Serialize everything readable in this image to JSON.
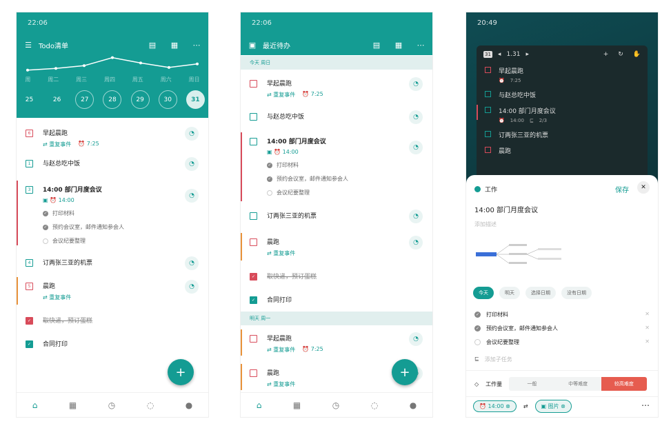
{
  "p1": {
    "time": "22:06",
    "title": "Todo清单",
    "badge": "8",
    "week": [
      "周",
      "周二",
      "周三",
      "周四",
      "周五",
      "周六",
      "周日"
    ],
    "dates": [
      "25",
      "26",
      "27",
      "28",
      "29",
      "30",
      "31"
    ],
    "trend": [
      0.2,
      0.3,
      0.45,
      0.9,
      0.6,
      0.35,
      0.55
    ],
    "items": [
      {
        "t": "早起晨跑",
        "meta1": "重复事件",
        "meta2": "7:25",
        "n": "6"
      },
      {
        "t": "与赵总吃中饭",
        "n": "1"
      },
      {
        "t": "14:00 部门月度会议",
        "meta2": "14:00",
        "n": "3",
        "subs": [
          "打印材料",
          "预约会议室，邮件通知参会人",
          "会议纪要整理"
        ]
      },
      {
        "t": "订两张三亚的机票",
        "n": "4"
      },
      {
        "t": "晨跑",
        "meta1": "重复事件",
        "n": "5"
      },
      {
        "t": "取快递，预订蛋糕"
      },
      {
        "t": "合同打印"
      }
    ]
  },
  "p2": {
    "time": "22:06",
    "title": "最近待办",
    "today": "今天 周日",
    "tomorrow": "明天 周一",
    "items": [
      {
        "t": "早起晨跑",
        "meta1": "重复事件",
        "meta2": "7:25"
      },
      {
        "t": "与赵总吃中饭"
      },
      {
        "t": "14:00 部门月度会议",
        "meta2": "14:00",
        "subs": [
          "打印材料",
          "预约会议室，邮件通知参会人",
          "会议纪要整理"
        ]
      },
      {
        "t": "订两张三亚的机票"
      },
      {
        "t": "晨跑",
        "meta1": "重复事件"
      },
      {
        "t": "取快递，预订蛋糕"
      },
      {
        "t": "合同打印"
      }
    ],
    "tm": [
      {
        "t": "早起晨跑",
        "meta1": "重复事件",
        "meta2": "7:25"
      },
      {
        "t": "晨跑",
        "meta1": "重复事件"
      }
    ]
  },
  "p3": {
    "time": "20:49",
    "w_num": "31",
    "w_date": "1.31",
    "w_items": [
      {
        "t": "早起晨跑",
        "m": "7:25"
      },
      {
        "t": "与赵总吃中饭"
      },
      {
        "t": "14:00 部门月度会议",
        "m": "14:00",
        "m2": "2/3"
      },
      {
        "t": "订两张三亚的机票"
      },
      {
        "t": "晨跑"
      }
    ],
    "list": "工作",
    "save": "保存",
    "task": "14:00 部门月度会议",
    "desc": "添加描述",
    "chips": [
      "今天",
      "明天",
      "选择日期",
      "没有日期"
    ],
    "subs": [
      "打印材料",
      "预约会议室，邮件通知参会人",
      "会议纪要整理"
    ],
    "add_sub": "添加子任务",
    "effort": "工作量",
    "levels": [
      "一般",
      "中等难度",
      "较高难度"
    ],
    "time_chip": "14:00",
    "img_chip": "图片"
  }
}
